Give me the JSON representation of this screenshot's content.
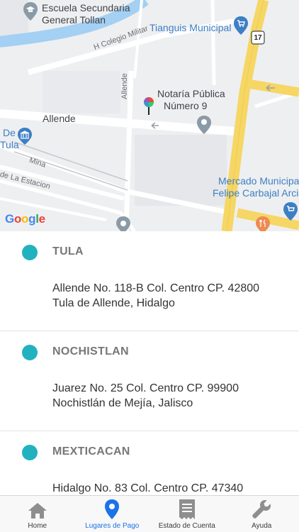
{
  "map": {
    "labels": {
      "school_line1": "Escuela Secundaria",
      "school_line2": "General Tollan",
      "tianguis": "Tianguis Municipal",
      "colegio_militar": "H Colegio Militar",
      "allende_vertical": "Allende",
      "notaria_line1": "Notaría Pública",
      "notaria_line2": "Número 9",
      "allende_street": "Allende",
      "de_tula_line1": "De",
      "de_tula_line2": "Tula",
      "mina": "Mina",
      "la_estacion": "de La Estacion",
      "mercado_line1": "Mercado Municipal",
      "mercado_line2": "Felipe Carbajal Arcia",
      "route_shield": "17"
    },
    "google": {
      "letters": [
        "G",
        "o",
        "o",
        "g",
        "l",
        "e"
      ],
      "colors": [
        "#4285f4",
        "#ea4335",
        "#fbbc05",
        "#4285f4",
        "#34a853",
        "#ea4335"
      ]
    },
    "colors": {
      "background": "#eeeff1",
      "major_road": "#f6d664",
      "river": "#a3d0f3",
      "poi_blue": "#3d7fc4",
      "poi_gray": "#8b9aa7",
      "restaurant": "#ef8a52"
    }
  },
  "places": [
    {
      "name": "TULA",
      "address_line1": "Allende No. 118-B Col. Centro CP. 42800",
      "address_line2": "Tula de Allende, Hidalgo"
    },
    {
      "name": "NOCHISTLAN",
      "address_line1": "Juarez No. 25 Col. Centro CP. 99900",
      "address_line2": "Nochistlán de Mejía, Jalisco"
    },
    {
      "name": "MEXTICACAN",
      "address_line1": "Hidalgo No. 83 Col. Centro CP. 47340",
      "address_line2": ""
    }
  ],
  "accent_color": "#22b1bf",
  "tabbar": {
    "tabs": [
      {
        "label": "Home",
        "icon": "home-icon",
        "active": false
      },
      {
        "label": "Lugares de Pago",
        "icon": "map-pin-icon",
        "active": true
      },
      {
        "label": "Estado de Cuenta",
        "icon": "receipt-icon",
        "active": false
      },
      {
        "label": "Ayuda",
        "icon": "wrench-icon",
        "active": false
      }
    ],
    "active_color": "#1a73e8"
  }
}
